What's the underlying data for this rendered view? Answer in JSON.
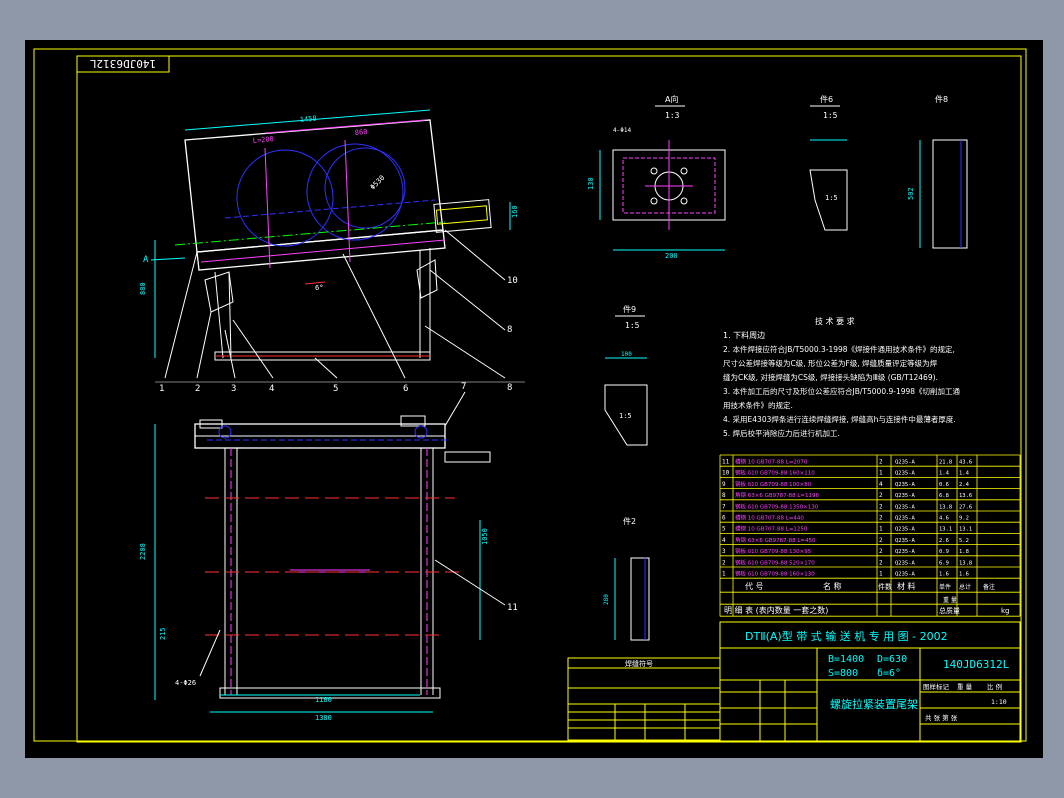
{
  "colors": {
    "background": "#000000",
    "frame": "#ffff00",
    "outline": "#ffffff",
    "magenta": "#ff40ff",
    "blue": "#3030ff",
    "cyan": "#00ffff",
    "green": "#00ff00",
    "red": "#ff3030",
    "margin": "#8e98a8"
  },
  "drawing_number_corner": "140JD6312L",
  "views": {
    "a_direction": "A向",
    "a_scale": "1:3",
    "part6": "件6",
    "part6_scale": "1:5",
    "part8": "件8",
    "part9": "件9",
    "part9_scale": "1:5",
    "part2": "件2",
    "slope_label": "1:5"
  },
  "part_numbers": [
    "1",
    "2",
    "3",
    "4",
    "5",
    "6",
    "7",
    "8",
    "9",
    "10",
    "11"
  ],
  "tech_req": {
    "title": "技 术 要 求",
    "lines": [
      "1. 下料周边",
      "2. 本件焊接应符合JB/T5000.3-1998《焊接件通用技术条件》的规定,",
      "   尺寸公差焊接等级为C级, 形位公差为F级, 焊缝质量评定等级为焊",
      "   缝为CK级, 对接焊缝为CS级, 焊接接头缺陷为Ⅲ级 (GB/T12469).",
      "3. 本件加工后的尺寸及形位公差应符合JB/T5000.9-1998《切削加工通",
      "   用技术条件》的规定.",
      "4. 采用E4303焊条进行连续焊缝焊接, 焊缝高h与连接件中最薄者厚度.",
      "5. 焊后校平消除应力后进行机加工."
    ]
  },
  "bom": {
    "headers": [
      "代  号",
      "名  称",
      "件数",
      "材  料",
      "单件",
      "总计",
      "备注"
    ],
    "weight_label": "重  量",
    "title_row": "明  细  表  (表内数量 一套之数)",
    "total_label": "总质量",
    "total_unit": "kg",
    "rows": [
      {
        "no": "11",
        "name": "槽钢 10 GB707-88 L=2070",
        "qty": "2",
        "mat": "Q235-A",
        "w1": "21.8",
        "w2": "43.6"
      },
      {
        "no": "10",
        "name": "钢板 δ10 GB709-88 160×110",
        "qty": "1",
        "mat": "Q235-A",
        "w1": "1.4",
        "w2": "1.4"
      },
      {
        "no": "9",
        "name": "钢板 δ10 GB709-88 100×80",
        "qty": "4",
        "mat": "Q235-A",
        "w1": "0.6",
        "w2": "2.4"
      },
      {
        "no": "8",
        "name": "角钢 63×6 GB9787-88 L=1196",
        "qty": "2",
        "mat": "Q235-A",
        "w1": "6.8",
        "w2": "13.6"
      },
      {
        "no": "7",
        "name": "钢板 δ10 GB709-88 1350×130",
        "qty": "2",
        "mat": "Q235-A",
        "w1": "13.8",
        "w2": "27.6"
      },
      {
        "no": "6",
        "name": "槽钢 10 GB707-88 L=440",
        "qty": "2",
        "mat": "Q235-A",
        "w1": "4.6",
        "w2": "9.2"
      },
      {
        "no": "5",
        "name": "槽钢 10 GB707-88 L=1250",
        "qty": "1",
        "mat": "Q235-A",
        "w1": "13.1",
        "w2": "13.1"
      },
      {
        "no": "4",
        "name": "角钢 63×6 GB9787-88 L=450",
        "qty": "2",
        "mat": "Q235-A",
        "w1": "2.6",
        "w2": "5.2"
      },
      {
        "no": "3",
        "name": "钢板 δ10 GB709-88 130×95",
        "qty": "2",
        "mat": "Q235-A",
        "w1": "0.9",
        "w2": "1.8"
      },
      {
        "no": "2",
        "name": "钢板 δ10 GB709-88 520×170",
        "qty": "2",
        "mat": "Q235-A",
        "w1": "6.9",
        "w2": "13.8"
      },
      {
        "no": "1",
        "name": "钢板 δ10 GB709-88 160×130",
        "qty": "1",
        "mat": "Q235-A",
        "w1": "1.6",
        "w2": "1.6"
      }
    ]
  },
  "title_block": {
    "series": "DTⅡ(A)型  带 式 输 送 机 专 用 图 - 2002",
    "param_b": "B=1400",
    "param_d": "D=630",
    "param_s": "S=800",
    "param_angle": "δ=6°",
    "drawing_no": "140JD6312L",
    "part_name": "螺旋拉紧装置尾架",
    "stage_label": "图样标记",
    "weight_label": "重 量",
    "scale_label": "比 例",
    "scale_value": "1:10",
    "sheet_label": "共  张  第  张"
  },
  "weld_table": {
    "title": "焊缝符号",
    "rows": [
      "",
      "",
      "",
      "",
      ""
    ]
  }
}
